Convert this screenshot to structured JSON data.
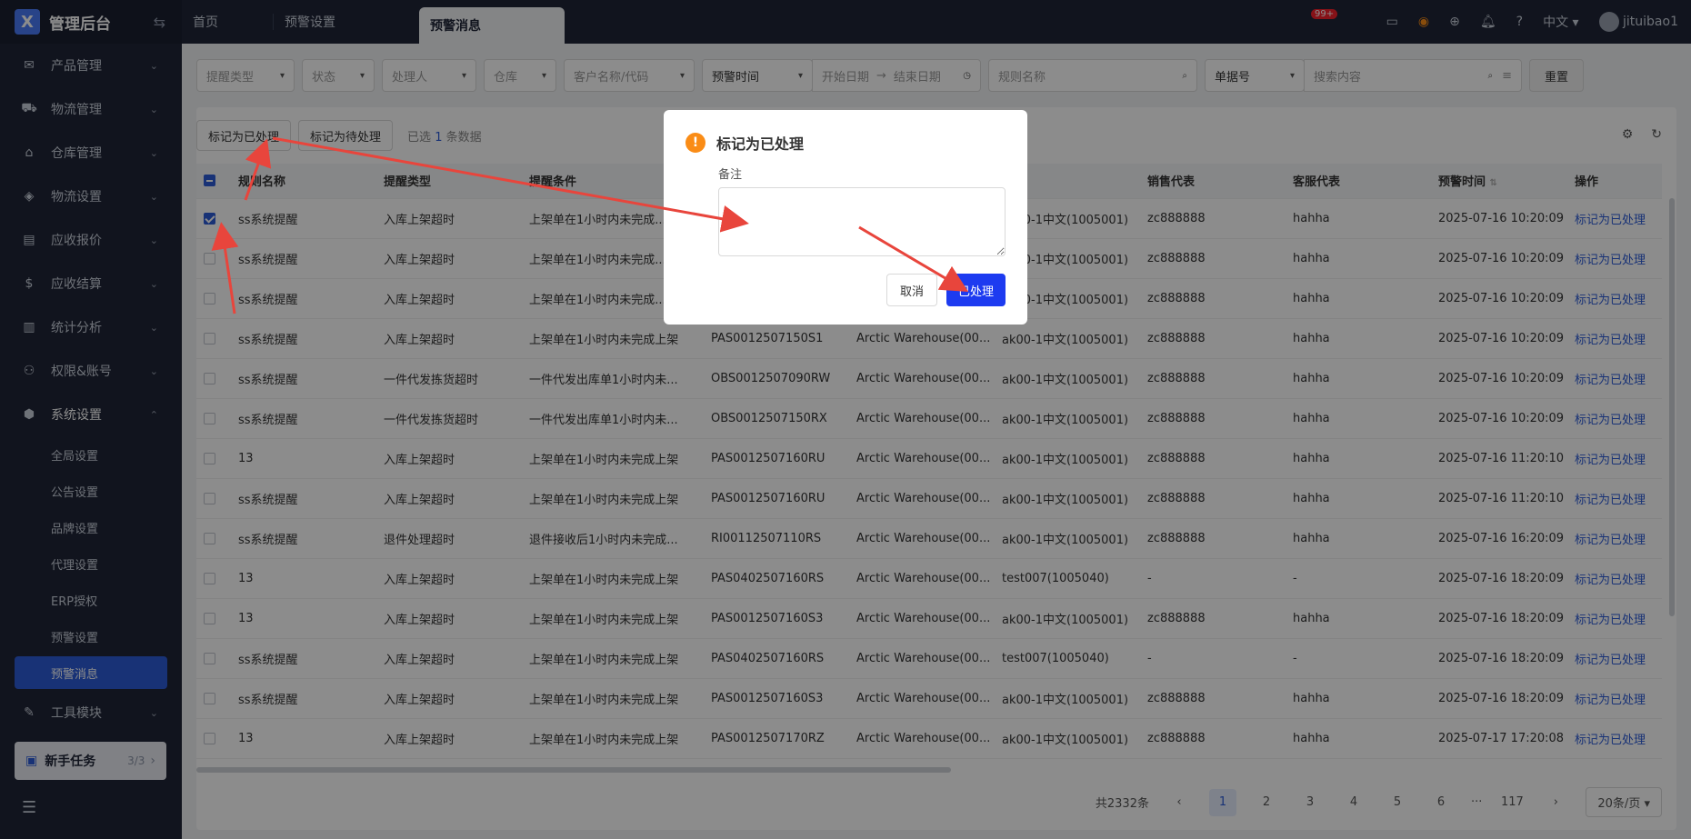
{
  "sidebar": {
    "logo_mark": "X",
    "title": "管理后台",
    "toggle": "⇆",
    "menus": [
      {
        "label": "产品管理",
        "icon": "✉"
      },
      {
        "label": "物流管理",
        "icon": "⛟"
      },
      {
        "label": "仓库管理",
        "icon": "⌂"
      },
      {
        "label": "物流设置",
        "icon": "◈"
      },
      {
        "label": "应收报价",
        "icon": "▤"
      },
      {
        "label": "应收结算",
        "icon": "$"
      },
      {
        "label": "统计分析",
        "icon": "▥"
      },
      {
        "label": "权限&账号",
        "icon": "⚇"
      },
      {
        "label": "系统设置",
        "icon": "⬢"
      }
    ],
    "sub_items": [
      "全局设置",
      "公告设置",
      "品牌设置",
      "代理设置",
      "ERP授权",
      "预警设置",
      "预警消息"
    ],
    "tool_menu": {
      "label": "工具模块",
      "icon": "✎"
    },
    "task": {
      "icon": "▣",
      "label": "新手任务",
      "count": "3/3"
    },
    "bottom_icon": "☰"
  },
  "topbar": {
    "tabs": [
      "首页",
      "预警设置",
      "预警消息"
    ],
    "badge": "99+",
    "lang": "中文",
    "user": "jituibao1"
  },
  "filters": {
    "remind_type": "提醒类型",
    "status": "状态",
    "handler": "处理人",
    "warehouse": "仓库",
    "customer": "客户名称/代码",
    "time_type": "预警时间",
    "start_date": "开始日期",
    "end_date": "结束日期",
    "rule_name": "规则名称",
    "doc_no": "单据号",
    "search": "搜索内容",
    "reset": "重置"
  },
  "actions": {
    "mark_done": "标记为已处理",
    "mark_pending": "标记为待处理",
    "selected_prefix": "已选",
    "selected_count": "1",
    "selected_suffix": "条数据"
  },
  "table": {
    "headers": [
      "规则名称",
      "提醒类型",
      "提醒条件",
      "",
      "",
      "",
      "销售代表",
      "客服代表",
      "预警时间",
      "操作"
    ],
    "rows": [
      [
        "ss系统提醒",
        "入库上架超时",
        "上架单在1小时内未完成...",
        "",
        "",
        "ak00-1中文(1005001)",
        "zc888888",
        "hahha",
        "2025-07-16 10:20:09",
        "标记为已处理"
      ],
      [
        "ss系统提醒",
        "入库上架超时",
        "上架单在1小时内未完成...",
        "",
        "",
        "ak00-1中文(1005001)",
        "zc888888",
        "hahha",
        "2025-07-16 10:20:09",
        "标记为已处理"
      ],
      [
        "ss系统提醒",
        "入库上架超时",
        "上架单在1小时内未完成...",
        "",
        "",
        "ak00-1中文(1005001)",
        "zc888888",
        "hahha",
        "2025-07-16 10:20:09",
        "标记为已处理"
      ],
      [
        "ss系统提醒",
        "入库上架超时",
        "上架单在1小时内未完成上架",
        "PAS0012507150S1",
        "Arctic Warehouse(00...",
        "ak00-1中文(1005001)",
        "zc888888",
        "hahha",
        "2025-07-16 10:20:09",
        "标记为已处理"
      ],
      [
        "ss系统提醒",
        "一件代发拣货超时",
        "一件代发出库单1小时内未...",
        "OBS0012507090RW",
        "Arctic Warehouse(00...",
        "ak00-1中文(1005001)",
        "zc888888",
        "hahha",
        "2025-07-16 10:20:09",
        "标记为已处理"
      ],
      [
        "ss系统提醒",
        "一件代发拣货超时",
        "一件代发出库单1小时内未...",
        "OBS0012507150RX",
        "Arctic Warehouse(00...",
        "ak00-1中文(1005001)",
        "zc888888",
        "hahha",
        "2025-07-16 10:20:09",
        "标记为已处理"
      ],
      [
        "13",
        "入库上架超时",
        "上架单在1小时内未完成上架",
        "PAS0012507160RU",
        "Arctic Warehouse(00...",
        "ak00-1中文(1005001)",
        "zc888888",
        "hahha",
        "2025-07-16 11:20:10",
        "标记为已处理"
      ],
      [
        "ss系统提醒",
        "入库上架超时",
        "上架单在1小时内未完成上架",
        "PAS0012507160RU",
        "Arctic Warehouse(00...",
        "ak00-1中文(1005001)",
        "zc888888",
        "hahha",
        "2025-07-16 11:20:10",
        "标记为已处理"
      ],
      [
        "ss系统提醒",
        "退件处理超时",
        "退件接收后1小时内未完成...",
        "RI00112507110RS",
        "Arctic Warehouse(00...",
        "ak00-1中文(1005001)",
        "zc888888",
        "hahha",
        "2025-07-16 16:20:09",
        "标记为已处理"
      ],
      [
        "13",
        "入库上架超时",
        "上架单在1小时内未完成上架",
        "PAS0402507160RS",
        "Arctic Warehouse(00...",
        "test007(1005040)",
        "-",
        "-",
        "2025-07-16 18:20:09",
        "标记为已处理"
      ],
      [
        "13",
        "入库上架超时",
        "上架单在1小时内未完成上架",
        "PAS0012507160S3",
        "Arctic Warehouse(00...",
        "ak00-1中文(1005001)",
        "zc888888",
        "hahha",
        "2025-07-16 18:20:09",
        "标记为已处理"
      ],
      [
        "ss系统提醒",
        "入库上架超时",
        "上架单在1小时内未完成上架",
        "PAS0402507160RS",
        "Arctic Warehouse(00...",
        "test007(1005040)",
        "-",
        "-",
        "2025-07-16 18:20:09",
        "标记为已处理"
      ],
      [
        "ss系统提醒",
        "入库上架超时",
        "上架单在1小时内未完成上架",
        "PAS0012507160S3",
        "Arctic Warehouse(00...",
        "ak00-1中文(1005001)",
        "zc888888",
        "hahha",
        "2025-07-16 18:20:09",
        "标记为已处理"
      ],
      [
        "13",
        "入库上架超时",
        "上架单在1小时内未完成上架",
        "PAS0012507170RZ",
        "Arctic Warehouse(00...",
        "ak00-1中文(1005001)",
        "zc888888",
        "hahha",
        "2025-07-17 17:20:08",
        "标记为已处理"
      ]
    ]
  },
  "pagination": {
    "total": "共2332条",
    "pages": [
      "1",
      "2",
      "3",
      "4",
      "5",
      "6"
    ],
    "ellipsis": "···",
    "last": "117",
    "page_size": "20条/页"
  },
  "modal": {
    "title": "标记为已处理",
    "remark_label": "备注",
    "cancel": "取消",
    "confirm": "已处理"
  },
  "colors": {
    "sidebar_bg": "#1f2537",
    "primary": "#2d5bd7",
    "confirm": "#1d3bf0",
    "warning": "#fa8c16",
    "annotation_arrow": "#e8453c"
  }
}
